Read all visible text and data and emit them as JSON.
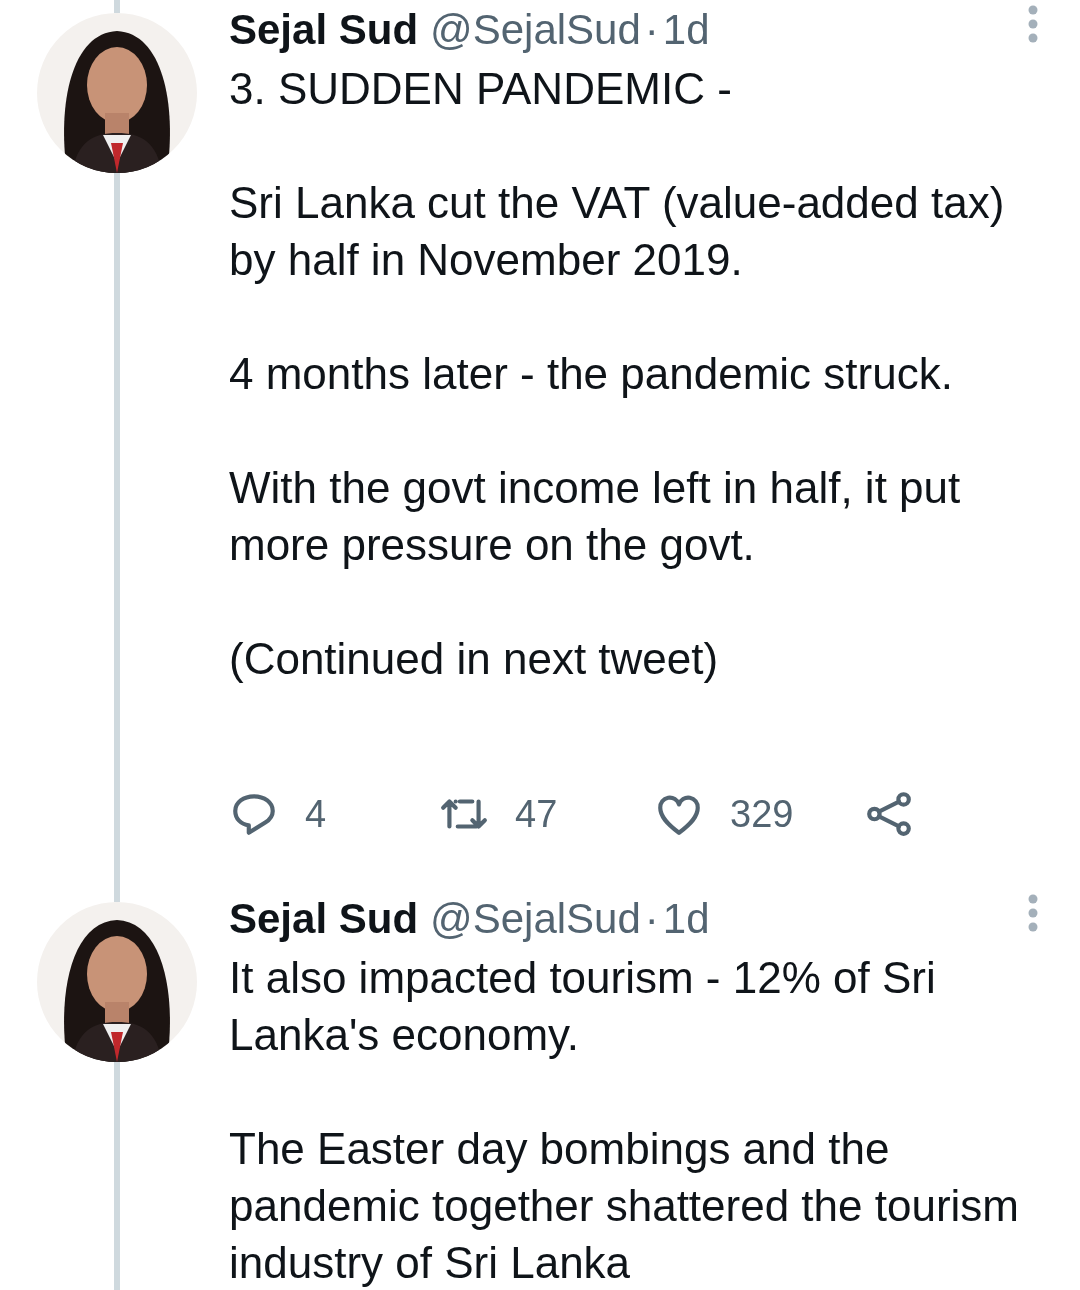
{
  "tweets": [
    {
      "author": {
        "name": "Sejal Sud",
        "handle": "@SejalSud"
      },
      "separator": "·",
      "time": "1d",
      "paragraphs": [
        "3. SUDDEN PANDEMIC -",
        "Sri Lanka cut the VAT (value-added tax) by half in November 2019.",
        "4 months later - the pandemic struck.",
        "With the govt income left in half, it put more pressure on the govt.",
        "(Continued in next tweet)"
      ],
      "actions": {
        "reply": "4",
        "retweet": "47",
        "like": "329"
      }
    },
    {
      "author": {
        "name": "Sejal Sud",
        "handle": "@SejalSud"
      },
      "separator": "·",
      "time": "1d",
      "paragraphs": [
        "It also impacted tourism - 12% of Sri Lanka's economy.",
        "The Easter day bombings and the pandemic together shattered the tourism industry of Sri Lanka"
      ]
    }
  ]
}
